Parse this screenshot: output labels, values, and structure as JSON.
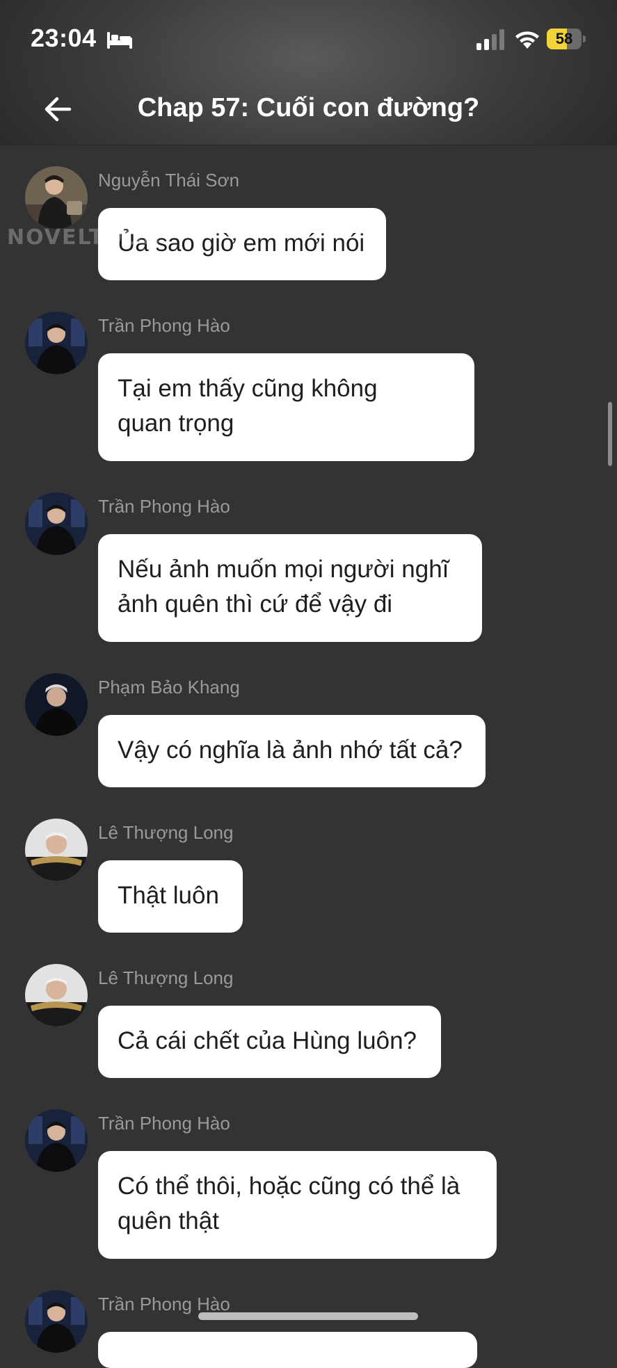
{
  "status_bar": {
    "time": "23:04",
    "sleep_icon": "bed-icon",
    "signal_icon": "cellular-signal-icon",
    "wifi_icon": "wifi-icon",
    "battery_level": "58",
    "battery_fraction": 0.58,
    "battery_color": "#f2d43a"
  },
  "header": {
    "back_icon": "arrow-left-icon",
    "title": "Chap 57: Cuối con đường?"
  },
  "watermark": "NOVELTOON",
  "messages": [
    {
      "sender": "Nguyễn Thái Sơn",
      "text": "Ủa sao giờ em mới nói"
    },
    {
      "sender": "Trần Phong Hào",
      "text": "Tại em thấy cũng không\nquan trọng"
    },
    {
      "sender": "Trần Phong Hào",
      "text": "Nếu ảnh muốn mọi người nghĩ\nảnh quên thì cứ để vậy đi"
    },
    {
      "sender": "Phạm Bảo Khang",
      "text": "Vậy có nghĩa là ảnh nhớ tất cả?"
    },
    {
      "sender": "Lê Thượng Long",
      "text": "Thật luôn"
    },
    {
      "sender": "Lê Thượng Long",
      "text": "Cả cái chết của Hùng luôn?"
    },
    {
      "sender": "Trần Phong Hào",
      "text": "Có thể thôi, hoặc cũng có thể là\nquên thật"
    },
    {
      "sender": "Trần Phong Hào",
      "text": ""
    }
  ],
  "colors": {
    "background": "#333333",
    "bubble": "#ffffff",
    "sender_text": "#9a9a9a"
  }
}
